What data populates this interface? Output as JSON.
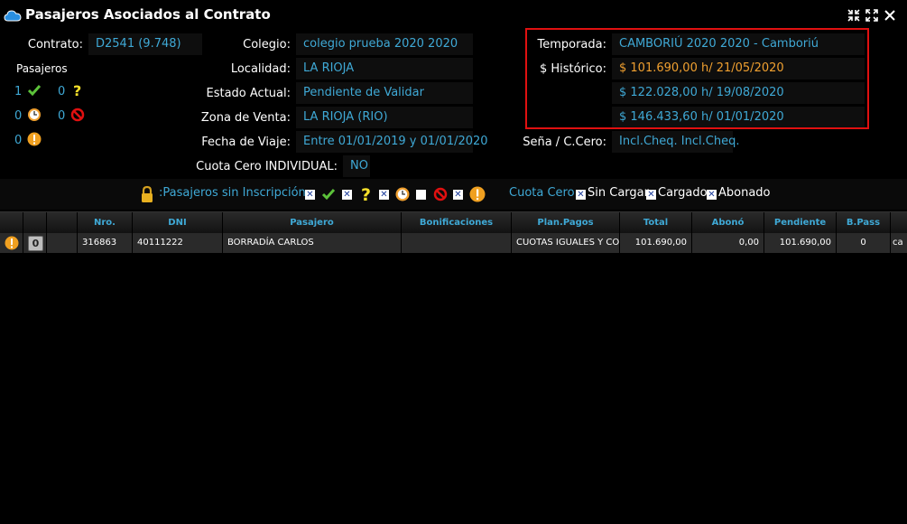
{
  "window": {
    "title": "Pasajeros Asociados al Contrato"
  },
  "fields": {
    "contrato_label": "Contrato:",
    "contrato_value": "D2541 (9.748)",
    "colegio_label": "Colegio:",
    "colegio_value": "colegio prueba 2020 2020",
    "localidad_label": "Localidad:",
    "localidad_value": "LA RIOJA",
    "estado_label": "Estado Actual:",
    "estado_value": "Pendiente de Validar",
    "zona_label": "Zona de Venta:",
    "zona_value": "LA RIOJA (RIO)",
    "fecha_label": "Fecha de Viaje:",
    "fecha_value": "Entre 01/01/2019 y 01/01/2020",
    "cuota_label": "Cuota Cero INDIVIDUAL:",
    "cuota_value": "NO",
    "temporada_label": "Temporada:",
    "temporada_value": "CAMBORIÚ 2020 2020 - Camboriú",
    "historico_label": "$ Histórico:",
    "historico_1": "$ 101.690,00 h/ 21/05/2020",
    "historico_2": "$ 122.028,00 h/ 19/08/2020",
    "historico_3": "$ 146.433,60 h/ 01/01/2020",
    "sena_label": "Seña / C.Cero:",
    "sena_value": "Incl.Cheq. Incl.Cheq."
  },
  "pasajeros": {
    "label": "Pasajeros",
    "ok_count": "1",
    "pending_count": "0",
    "clock_count": "0",
    "blocked_count": "0",
    "alert_count": "0"
  },
  "legend": {
    "sin_inscripcion": ":Pasajeros sin Inscripción",
    "cuota_cero_label": "Cuota Cero:",
    "sin_cargar": "Sin Cargar",
    "cargado": "Cargado",
    "abonado": "Abonado"
  },
  "table": {
    "headers": [
      "Nro.",
      "DNI",
      "Pasajero",
      "Bonificaciones",
      "Plan.Pagos",
      "Total",
      "Abonó",
      "Pendiente",
      "B.Pass"
    ],
    "rows": [
      {
        "badge": "0",
        "nro": "316863",
        "dni": "40111222",
        "pasajero": "BORRADÍA CARLOS",
        "bonificaciones": "",
        "plan": "CUOTAS IGUALES Y COI",
        "total": "101.690,00",
        "abono": "0,00",
        "pendiente": "101.690,00",
        "bpass": "0",
        "extra": "ca"
      }
    ]
  },
  "colors": {
    "accent": "#3fa9d6",
    "warning": "#f0a030",
    "highlight_border": "#e01010"
  }
}
